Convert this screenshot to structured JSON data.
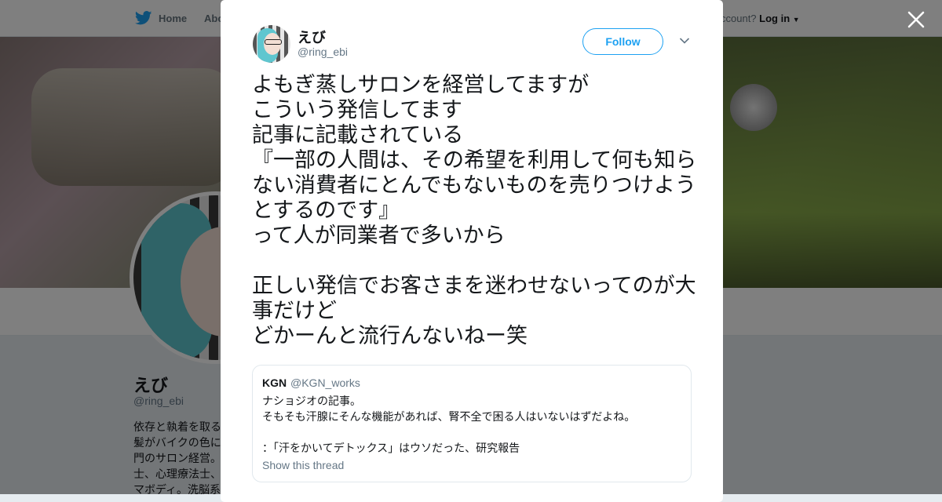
{
  "background": {
    "nav": {
      "home_label": "Home",
      "about_label": "Abo",
      "account_text": "ccount?",
      "login_label": "Log in"
    },
    "profile": {
      "name": "えび",
      "handle": "@ring_ebi",
      "bio": "依存と執着を取る\n髪がバイクの色に\n門のサロン経営。\n士、心理療法士、\nマボディ。洗脳系"
    }
  },
  "tweet": {
    "author_name": "えび",
    "author_handle": "@ring_ebi",
    "follow_label": "Follow",
    "text": "よもぎ蒸しサロンを経営してますが\nこういう発信してます\n記事に記載されている\n『一部の人間は、その希望を利用して何も知らない消費者にとんでもないものを売りつけようとするのです』\nって人が同業者で多いから\n\n正しい発信でお客さまを迷わせないってのが大事だけど\nどかーんと流行んないねー笑",
    "quote": {
      "name": "KGN",
      "handle": "@KGN_works",
      "text": "ナショジオの記事。\nそもそも汗腺にそんな機能があれば、腎不全で困る人はいないはずだよね。\n\n：「汗をかいてデトックス」はウソだった、研究報告",
      "show_thread_label": "Show this thread"
    }
  },
  "colors": {
    "accent": "#1da1f2",
    "text": "#14171a",
    "secondary_text": "#657786",
    "overlay": "rgba(0,0,0,0.5)"
  },
  "icons": [
    "twitter-bird-icon",
    "close-icon",
    "chevron-down-icon",
    "caret-down-icon"
  ]
}
